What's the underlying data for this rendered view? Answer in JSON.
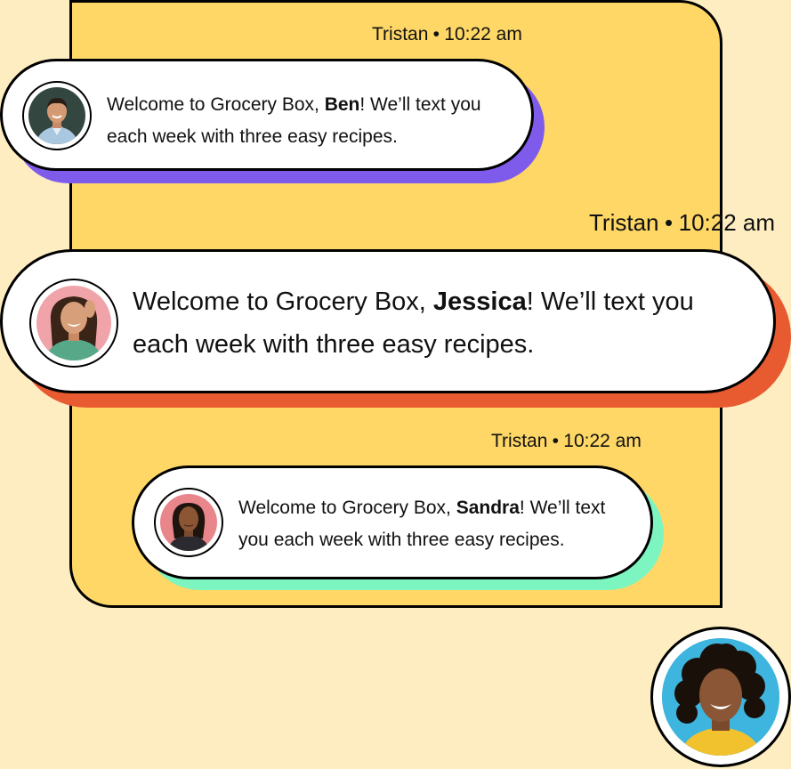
{
  "messages": [
    {
      "sender": "Tristan",
      "separator": "•",
      "time": "10:22 am",
      "text_before": "Welcome to Grocery Box, ",
      "name": "Ben",
      "text_after": "! We’ll text you",
      "line2": "each week with three easy recipes.",
      "shadow_color": "#7F5BEB"
    },
    {
      "sender": "Tristan",
      "separator": "•",
      "time": "10:22 am",
      "text_before": "Welcome to Grocery Box, ",
      "name": "Jessica",
      "text_after": "! We’ll text you",
      "line2": "each week with three easy recipes.",
      "shadow_color": "#E85A30"
    },
    {
      "sender": "Tristan",
      "separator": "•",
      "time": "10:22 am",
      "text_before": "Welcome to Grocery Box, ",
      "name": "Sandra",
      "text_after": "! We’ll text",
      "line2": "you each week with three easy recipes.",
      "shadow_color": "#7DF5C0"
    }
  ],
  "colors": {
    "page_background": "#FEEDC1",
    "panel": "#FED766",
    "avatar_background_blue": "#3EB5DE"
  }
}
